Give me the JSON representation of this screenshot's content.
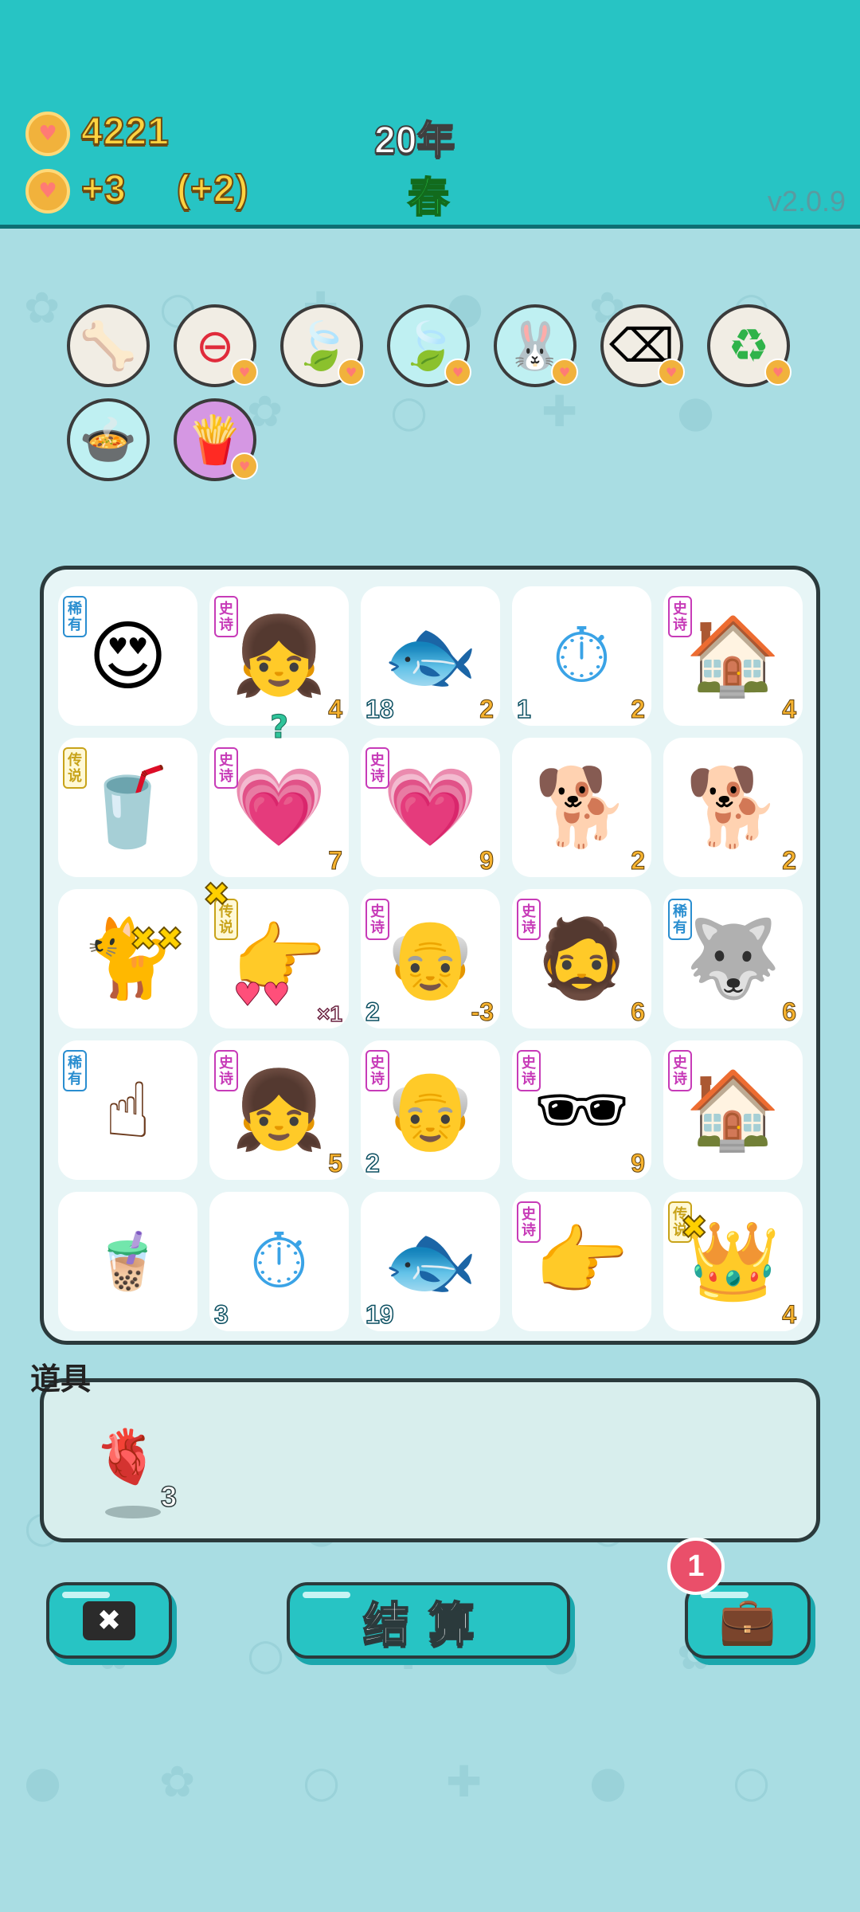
{
  "header": {
    "coins": "4221",
    "income": "+3",
    "income_bonus": "(+2)",
    "year": "20年",
    "season": "春",
    "version": "v2.0.9"
  },
  "abilities": [
    {
      "name": "pet-food-ability",
      "glyph": "🦴"
    },
    {
      "name": "remove-ability",
      "glyph": "⊖"
    },
    {
      "name": "yellow-leaf-ability",
      "glyph": "🍃"
    },
    {
      "name": "green-leaf-ability",
      "glyph": "🍃"
    },
    {
      "name": "rabbit-ability",
      "glyph": "🐰"
    },
    {
      "name": "delete-ability",
      "glyph": "⌫"
    },
    {
      "name": "reroll-ability",
      "glyph": "♻"
    },
    {
      "name": "duck-pot-ability",
      "glyph": "🍲"
    },
    {
      "name": "fries-ability",
      "glyph": "🍟"
    }
  ],
  "board": [
    [
      {
        "name": "bald-man-heart-eyes",
        "glyph": "😍",
        "tag": "稀有",
        "tag_type": "rare",
        "num_l": "",
        "num_r": ""
      },
      {
        "name": "braided-girl",
        "glyph": "👧",
        "tag": "史诗",
        "tag_type": "epic",
        "num_l": "",
        "num_r": "4"
      },
      {
        "name": "goldfish",
        "glyph": "🐟",
        "tag": "",
        "tag_type": "",
        "num_l": "18",
        "num_r": "2"
      },
      {
        "name": "stopwatch-card",
        "glyph": "⏱",
        "tag": "",
        "tag_type": "",
        "num_l": "1",
        "num_r": "2"
      },
      {
        "name": "rabbit-house",
        "glyph": "🏠",
        "tag": "史诗",
        "tag_type": "epic",
        "num_l": "",
        "num_r": "4"
      }
    ],
    [
      {
        "name": "bubble-tea-large",
        "glyph": "🥤",
        "tag": "传说",
        "tag_type": "legend",
        "num_l": "",
        "num_r": ""
      },
      {
        "name": "mystery-heart-box",
        "glyph": "💗",
        "tag": "史诗",
        "tag_type": "epic",
        "num_l": "",
        "num_r": "7"
      },
      {
        "name": "heart-face-girl",
        "glyph": "💗",
        "tag": "史诗",
        "tag_type": "epic",
        "num_l": "",
        "num_r": "9"
      },
      {
        "name": "husky-dog",
        "glyph": "🐕",
        "tag": "",
        "tag_type": "",
        "num_l": "",
        "num_r": "2"
      },
      {
        "name": "husky-dog",
        "glyph": "🐕",
        "tag": "",
        "tag_type": "",
        "num_l": "",
        "num_r": "2"
      }
    ],
    [
      {
        "name": "yellow-cat",
        "glyph": "🐈",
        "tag": "",
        "tag_type": "",
        "num_l": "",
        "num_r": ""
      },
      {
        "name": "pointing-hand-gold",
        "glyph": "👉",
        "tag": "传说",
        "tag_type": "legend",
        "num_l": "",
        "num_r": "×1"
      },
      {
        "name": "grandpa-heart-eyes",
        "glyph": "👴",
        "tag": "史诗",
        "tag_type": "epic",
        "num_l": "2",
        "num_r": "-3"
      },
      {
        "name": "green-hat-man",
        "glyph": "🧔",
        "tag": "史诗",
        "tag_type": "epic",
        "num_l": "",
        "num_r": "6"
      },
      {
        "name": "grey-husky",
        "glyph": "🐺",
        "tag": "稀有",
        "tag_type": "rare",
        "num_l": "",
        "num_r": "6"
      }
    ],
    [
      {
        "name": "pointing-finger-brown",
        "glyph": "☝",
        "tag": "稀有",
        "tag_type": "rare",
        "num_l": "",
        "num_r": ""
      },
      {
        "name": "braided-girl",
        "glyph": "👧",
        "tag": "史诗",
        "tag_type": "epic",
        "num_l": "",
        "num_r": "5"
      },
      {
        "name": "grandpa-heart-eyes",
        "glyph": "👴",
        "tag": "史诗",
        "tag_type": "epic",
        "num_l": "2",
        "num_r": ""
      },
      {
        "name": "green-hat-sunglasses-man",
        "glyph": "🕶",
        "tag": "史诗",
        "tag_type": "epic",
        "num_l": "",
        "num_r": "9"
      },
      {
        "name": "rabbit-house",
        "glyph": "🏠",
        "tag": "史诗",
        "tag_type": "epic",
        "num_l": "",
        "num_r": ""
      }
    ],
    [
      {
        "name": "bubble-tea-small",
        "glyph": "🧋",
        "tag": "",
        "tag_type": "",
        "num_l": "",
        "num_r": ""
      },
      {
        "name": "stopwatch-card",
        "glyph": "⏱",
        "tag": "",
        "tag_type": "",
        "num_l": "3",
        "num_r": ""
      },
      {
        "name": "goldfish",
        "glyph": "🐟",
        "tag": "",
        "tag_type": "",
        "num_l": "19",
        "num_r": ""
      },
      {
        "name": "pointing-hand-grey",
        "glyph": "👉",
        "tag": "史诗",
        "tag_type": "epic",
        "num_l": "",
        "num_r": ""
      },
      {
        "name": "king-husky",
        "glyph": "👑",
        "tag": "传说",
        "tag_type": "legend",
        "num_l": "",
        "num_r": "4"
      }
    ]
  ],
  "board_extras": {
    "question_mark": "?"
  },
  "items_panel": {
    "title": "道具",
    "item_glyph": "🫀",
    "item_count": "3"
  },
  "buttons": {
    "delete_glyph": "✖",
    "settle_label": "结算",
    "bag_glyph": "💼",
    "bag_badge": "1"
  },
  "colors": {
    "header_bg": "#27c4c4",
    "page_bg": "#a9dde3",
    "board_bg": "#e7f5f6",
    "coin_text": "#ffd340",
    "season_green": "#2ee050",
    "badge_red": "#ea4f6a"
  }
}
